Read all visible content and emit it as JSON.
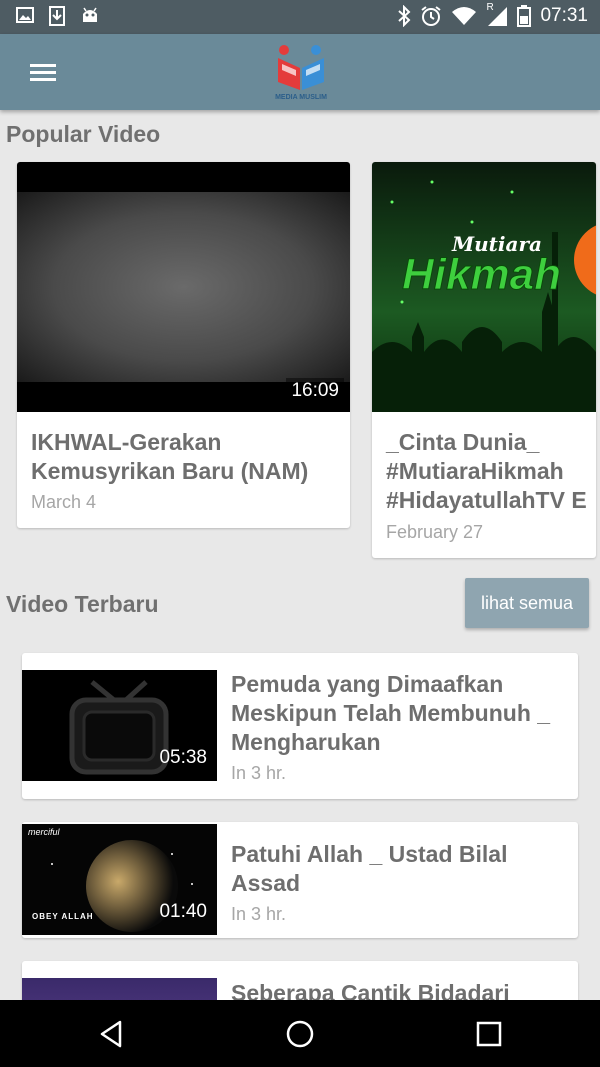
{
  "status_bar": {
    "time": "07:31",
    "left_icons": [
      "image-icon",
      "download-icon",
      "android-icon"
    ],
    "right_icons": [
      "bluetooth-icon",
      "alarm-icon",
      "wifi-icon",
      "signal-icon",
      "battery-icon"
    ],
    "signal_label": "R"
  },
  "app_bar": {
    "logo_text": "MEDIA MUSLIM"
  },
  "popular": {
    "title": "Popular Video",
    "videos": [
      {
        "title": "IKHWAL-Gerakan\nKemusyrikan Baru (NAM)",
        "date": "March 4",
        "duration": "16:09"
      },
      {
        "title": "_Cinta Dunia_\n#MutiaraHikmah\n#HidayatullahTV E",
        "date": "February 27",
        "thumb_text_small": "Mutiara",
        "thumb_text_big": "Hikmah"
      }
    ]
  },
  "latest": {
    "title": "Video Terbaru",
    "see_all_label": "lihat semua",
    "videos": [
      {
        "title": "Pemuda yang Dimaafkan\nMeskipun Telah Membunuh _\nMengharukan",
        "date": "In 3 hr.",
        "duration": "05:38"
      },
      {
        "title": "Patuhi Allah _ Ustad Bilal\nAssad",
        "date": "In 3 hr.",
        "duration": "01:40",
        "thumb_text_top": "merciful",
        "thumb_text_bottom": "OBEY ALLAH"
      },
      {
        "title": "Seberapa Cantik Bidadari",
        "date": ""
      }
    ]
  },
  "colors": {
    "status_bar": "#4e5c63",
    "app_bar": "#6a8a99",
    "background": "#e8e8e8",
    "see_all_button": "#8fa5b0",
    "title_text": "#6e6e6e",
    "date_text": "#a6a6a6"
  }
}
